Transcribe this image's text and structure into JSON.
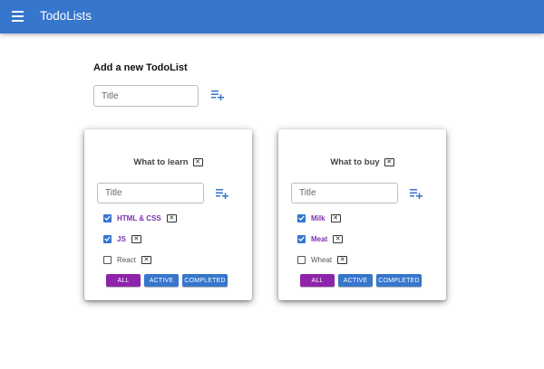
{
  "app": {
    "title": "TodoLists"
  },
  "add_list": {
    "heading": "Add a new TodoList",
    "input_placeholder": "Title"
  },
  "todolists": [
    {
      "title": "What to learn",
      "input_placeholder": "Title",
      "tasks": [
        {
          "label": "HTML & CSS",
          "done": true
        },
        {
          "label": "JS",
          "done": true
        },
        {
          "label": "React",
          "done": false
        }
      ],
      "filters": [
        "ALL",
        "ACTIVE",
        "COMPLETED"
      ],
      "selected_filter": "ALL"
    },
    {
      "title": "What to buy",
      "input_placeholder": "Title",
      "tasks": [
        {
          "label": "Milk",
          "done": true
        },
        {
          "label": "Meat",
          "done": true
        },
        {
          "label": "Wheat",
          "done": false
        }
      ],
      "filters": [
        "ALL",
        "ACTIVE",
        "COMPLETED"
      ],
      "selected_filter": "ALL"
    }
  ],
  "icons": {
    "menu": "menu-icon",
    "add": "playlist-add-icon",
    "delete": "close-box-icon",
    "check": "check-icon"
  },
  "colors": {
    "primary": "#3676cc",
    "secondary": "#8e24aa",
    "done_text": "#7b2fb0"
  }
}
